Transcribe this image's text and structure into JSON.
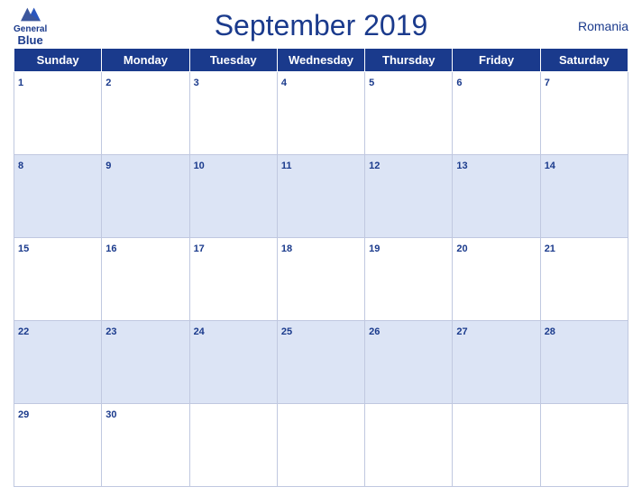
{
  "header": {
    "logo": {
      "general": "General",
      "blue": "Blue"
    },
    "title": "September 2019",
    "country": "Romania"
  },
  "weekdays": [
    "Sunday",
    "Monday",
    "Tuesday",
    "Wednesday",
    "Thursday",
    "Friday",
    "Saturday"
  ],
  "weeks": [
    [
      {
        "day": 1,
        "empty": false
      },
      {
        "day": 2,
        "empty": false
      },
      {
        "day": 3,
        "empty": false
      },
      {
        "day": 4,
        "empty": false
      },
      {
        "day": 5,
        "empty": false
      },
      {
        "day": 6,
        "empty": false
      },
      {
        "day": 7,
        "empty": false
      }
    ],
    [
      {
        "day": 8,
        "empty": false
      },
      {
        "day": 9,
        "empty": false
      },
      {
        "day": 10,
        "empty": false
      },
      {
        "day": 11,
        "empty": false
      },
      {
        "day": 12,
        "empty": false
      },
      {
        "day": 13,
        "empty": false
      },
      {
        "day": 14,
        "empty": false
      }
    ],
    [
      {
        "day": 15,
        "empty": false
      },
      {
        "day": 16,
        "empty": false
      },
      {
        "day": 17,
        "empty": false
      },
      {
        "day": 18,
        "empty": false
      },
      {
        "day": 19,
        "empty": false
      },
      {
        "day": 20,
        "empty": false
      },
      {
        "day": 21,
        "empty": false
      }
    ],
    [
      {
        "day": 22,
        "empty": false
      },
      {
        "day": 23,
        "empty": false
      },
      {
        "day": 24,
        "empty": false
      },
      {
        "day": 25,
        "empty": false
      },
      {
        "day": 26,
        "empty": false
      },
      {
        "day": 27,
        "empty": false
      },
      {
        "day": 28,
        "empty": false
      }
    ],
    [
      {
        "day": 29,
        "empty": false
      },
      {
        "day": 30,
        "empty": false
      },
      {
        "day": null,
        "empty": true
      },
      {
        "day": null,
        "empty": true
      },
      {
        "day": null,
        "empty": true
      },
      {
        "day": null,
        "empty": true
      },
      {
        "day": null,
        "empty": true
      }
    ]
  ],
  "colors": {
    "header_bg": "#1a3a8c",
    "row_even_bg": "#dce4f5",
    "row_odd_bg": "#ffffff",
    "text": "#1a3a8c"
  }
}
